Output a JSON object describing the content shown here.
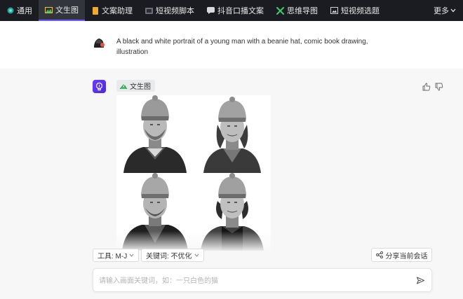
{
  "nav": {
    "tabs": [
      {
        "label": "通用",
        "icon": "globe-dot-icon",
        "active": false
      },
      {
        "label": "文生图",
        "icon": "image-icon",
        "active": true
      },
      {
        "label": "文案助理",
        "icon": "note-icon",
        "active": false
      },
      {
        "label": "短视频脚本",
        "icon": "film-icon",
        "active": false
      },
      {
        "label": "抖音口播文案",
        "icon": "chat-icon",
        "active": false
      },
      {
        "label": "思维导图",
        "icon": "mindmap-icon",
        "active": false
      },
      {
        "label": "短视频选题",
        "icon": "picture-icon",
        "active": false
      }
    ],
    "more_label": "更多"
  },
  "user_message": {
    "text": "A black and white portrait of a young man with a beanie hat, comic book drawing, illustration"
  },
  "bot_message": {
    "tag_label": "文生图",
    "image_grid": [
      "portrait-1",
      "portrait-2",
      "portrait-3",
      "portrait-4"
    ]
  },
  "toolbar": {
    "tool_label": "工具: M-J",
    "keyword_label": "关键词: 不优化",
    "share_label": "分享当前会话"
  },
  "input": {
    "placeholder": "请输入画面关键词，如：一只白色的猫"
  },
  "colors": {
    "nav_bg": "#1b1c21",
    "accent": "#6a5cff",
    "bot_avatar": "#5a34f0"
  }
}
